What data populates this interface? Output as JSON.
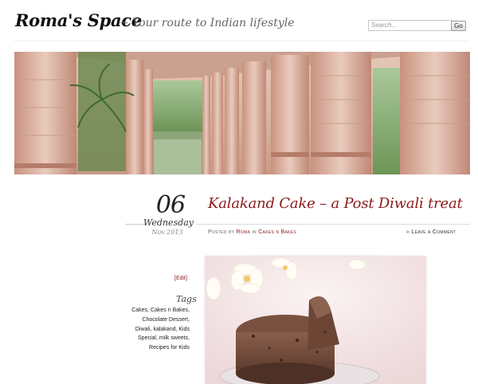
{
  "header": {
    "site_title": "Roma's Space",
    "tagline": "~ Your route to Indian lifestyle",
    "search_placeholder": "Search...",
    "go_label": "Go"
  },
  "post": {
    "date_day": "06",
    "date_weekday": "Wednesday",
    "date_month": "Nov 2013",
    "title": "Kalakand Cake – a Post Diwali treat",
    "meta_prefix": "Posted by ",
    "author": "Roma",
    "meta_mid": " in ",
    "category": "Cakes n Bakes",
    "leave_comment": "≈ Leave a Comment"
  },
  "sidebar": {
    "edit_label": "[Edit]",
    "tags_heading": "Tags",
    "tags": [
      "Cakes,",
      "Cakes n Bakes,",
      "Chocolate Dessert,",
      "Diwali,",
      "kalakand,",
      "Kids",
      "Special,",
      "milk sweets,",
      "Recipes for Kids"
    ]
  },
  "colors": {
    "accent": "#8b1a1a",
    "banner": "#d9b3a1"
  }
}
